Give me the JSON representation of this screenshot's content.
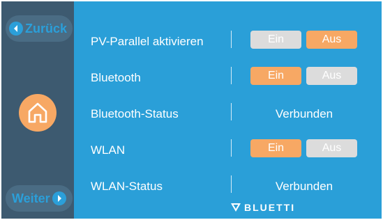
{
  "nav": {
    "back_label": "Zurück",
    "next_label": "Weiter",
    "home_icon": "home-icon"
  },
  "settings": [
    {
      "label": "PV-Parallel aktivieren",
      "type": "toggle",
      "on_label": "Ein",
      "off_label": "Aus",
      "selected": "Aus"
    },
    {
      "label": "Bluetooth",
      "type": "toggle",
      "on_label": "Ein",
      "off_label": "Aus",
      "selected": "Ein"
    },
    {
      "label": "Bluetooth-Status",
      "type": "status",
      "value": "Verbunden"
    },
    {
      "label": "WLAN",
      "type": "toggle",
      "on_label": "Ein",
      "off_label": "Aus",
      "selected": "Ein"
    },
    {
      "label": "WLAN-Status",
      "type": "status",
      "value": "Verbunden"
    }
  ],
  "brand": "BLUETTI",
  "colors": {
    "sidebar": "#3d5a70",
    "main": "#2a9fd8",
    "active": "#f7a864",
    "inactive": "#dcdcdc",
    "nav_text": "#2b9fd9"
  }
}
